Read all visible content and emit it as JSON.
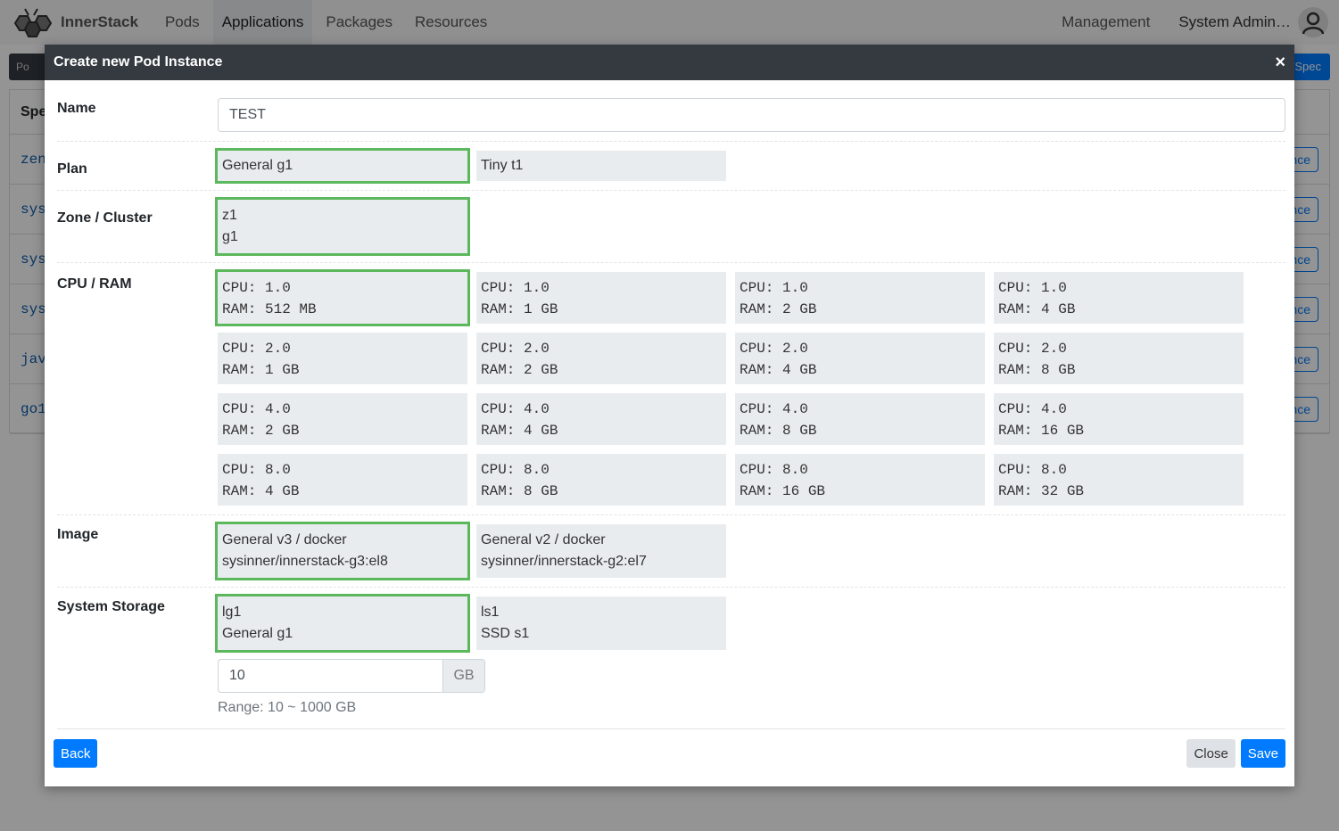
{
  "navbar": {
    "brand": "InnerStack",
    "items": [
      {
        "label": "Pods",
        "active": false
      },
      {
        "label": "Applications",
        "active": true
      },
      {
        "label": "Packages",
        "active": false
      },
      {
        "label": "Resources",
        "active": false
      }
    ],
    "right_item": "Management",
    "user_name": "System Admin…"
  },
  "background_page": {
    "toolbar_label": "Po",
    "right_button_label": "oSpec",
    "table_header": "Spe",
    "rows": [
      "zen",
      "sys",
      "sys",
      "sys",
      "jav",
      "go1"
    ],
    "row_button_label": "nce"
  },
  "modal": {
    "title": "Create new Pod Instance",
    "close_icon": "×",
    "fields": {
      "name": {
        "label": "Name",
        "value": "TEST"
      },
      "plan": {
        "label": "Plan",
        "options": [
          {
            "lines": [
              "General g1"
            ],
            "selected": true
          },
          {
            "lines": [
              "Tiny t1"
            ],
            "selected": false
          }
        ]
      },
      "zone": {
        "label": "Zone / Cluster",
        "options": [
          {
            "lines": [
              "z1",
              "g1"
            ],
            "selected": true
          }
        ]
      },
      "cpu_ram": {
        "label": "CPU / RAM",
        "options": [
          {
            "lines": [
              "CPU: 1.0",
              "RAM: 512 MB"
            ],
            "selected": true
          },
          {
            "lines": [
              "CPU: 1.0",
              "RAM: 1 GB"
            ],
            "selected": false
          },
          {
            "lines": [
              "CPU: 1.0",
              "RAM: 2 GB"
            ],
            "selected": false
          },
          {
            "lines": [
              "CPU: 1.0",
              "RAM: 4 GB"
            ],
            "selected": false
          },
          {
            "lines": [
              "CPU: 2.0",
              "RAM: 1 GB"
            ],
            "selected": false
          },
          {
            "lines": [
              "CPU: 2.0",
              "RAM: 2 GB"
            ],
            "selected": false
          },
          {
            "lines": [
              "CPU: 2.0",
              "RAM: 4 GB"
            ],
            "selected": false
          },
          {
            "lines": [
              "CPU: 2.0",
              "RAM: 8 GB"
            ],
            "selected": false
          },
          {
            "lines": [
              "CPU: 4.0",
              "RAM: 2 GB"
            ],
            "selected": false
          },
          {
            "lines": [
              "CPU: 4.0",
              "RAM: 4 GB"
            ],
            "selected": false
          },
          {
            "lines": [
              "CPU: 4.0",
              "RAM: 8 GB"
            ],
            "selected": false
          },
          {
            "lines": [
              "CPU: 4.0",
              "RAM: 16 GB"
            ],
            "selected": false
          },
          {
            "lines": [
              "CPU: 8.0",
              "RAM: 4 GB"
            ],
            "selected": false
          },
          {
            "lines": [
              "CPU: 8.0",
              "RAM: 8 GB"
            ],
            "selected": false
          },
          {
            "lines": [
              "CPU: 8.0",
              "RAM: 16 GB"
            ],
            "selected": false
          },
          {
            "lines": [
              "CPU: 8.0",
              "RAM: 32 GB"
            ],
            "selected": false
          }
        ]
      },
      "image": {
        "label": "Image",
        "options": [
          {
            "lines": [
              "General v3 / docker",
              "sysinner/innerstack-g3:el8"
            ],
            "selected": true
          },
          {
            "lines": [
              "General v2 / docker",
              "sysinner/innerstack-g2:el7"
            ],
            "selected": false
          }
        ]
      },
      "storage": {
        "label": "System Storage",
        "options": [
          {
            "lines": [
              "lg1",
              "General g1"
            ],
            "selected": true
          },
          {
            "lines": [
              "ls1",
              "SSD s1"
            ],
            "selected": false
          }
        ],
        "size_value": "10",
        "size_unit": "GB",
        "range_hint": "Range: 10 ~ 1000 GB"
      }
    },
    "buttons": {
      "back": "Back",
      "close": "Close",
      "save": "Save"
    }
  },
  "colors": {
    "primary": "#007bff",
    "selected_outline": "#5cb85c",
    "modal_header": "#343a40"
  }
}
